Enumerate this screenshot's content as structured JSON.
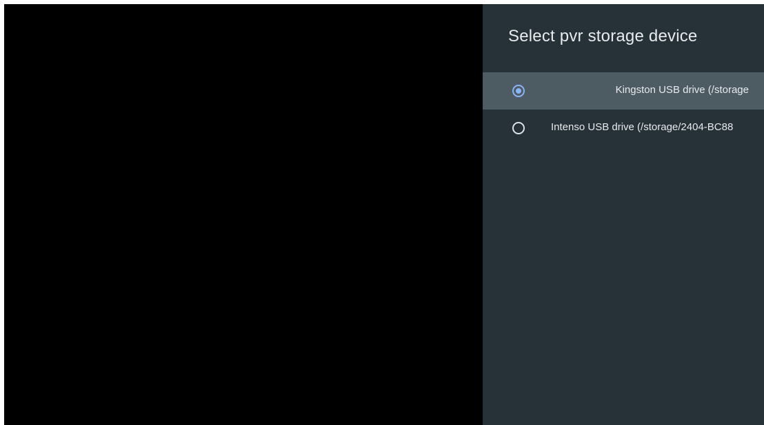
{
  "panel": {
    "title": "Select pvr storage device",
    "options": [
      {
        "label": "Kingston USB drive (/storage/...",
        "visible_label": "Kingston USB drive (/storage",
        "checked": true,
        "focused": true,
        "icon": "radio-checked-icon"
      },
      {
        "label": "Intenso USB drive (/storage/2404-BC88",
        "checked": false,
        "focused": false,
        "icon": "radio-unchecked-icon"
      }
    ]
  },
  "colors": {
    "panel_background": "#263238",
    "focused_row": "#4d5b63",
    "accent": "#8ab4f8",
    "text": "#e8eaed"
  }
}
